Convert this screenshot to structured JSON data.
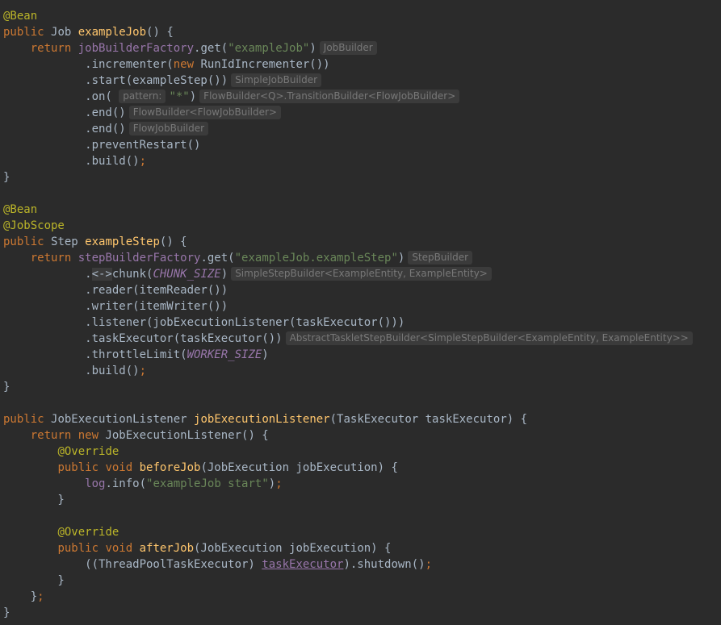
{
  "editor": {
    "theme": "darcula",
    "colors": {
      "background": "#2b2b2b",
      "text": "#a9b7c6",
      "keyword": "#cc7832",
      "annotation": "#bbb529",
      "method_declaration": "#ffc66d",
      "string": "#6a8759",
      "field": "#9876aa",
      "inlay_hint_text": "#787878",
      "inlay_hint_background": "#3b3b3b"
    },
    "lines": [
      [
        {
          "c": "ann",
          "t": "@Bean"
        }
      ],
      [
        {
          "c": "kw",
          "t": "public "
        },
        {
          "t": "Job "
        },
        {
          "c": "fn",
          "t": "exampleJob"
        },
        {
          "t": "() {"
        }
      ],
      [
        {
          "t": "    "
        },
        {
          "c": "kw",
          "t": "return "
        },
        {
          "c": "fld",
          "t": "jobBuilderFactory"
        },
        {
          "t": ".get("
        },
        {
          "c": "str",
          "t": "\"exampleJob\""
        },
        {
          "t": ")"
        },
        {
          "c": "hint",
          "t": "JobBuilder"
        }
      ],
      [
        {
          "t": "            .incrementer("
        },
        {
          "c": "kw",
          "t": "new "
        },
        {
          "t": "RunIdIncrementer())"
        }
      ],
      [
        {
          "t": "            .start(exampleStep())"
        },
        {
          "c": "hint",
          "t": "SimpleJobBuilder"
        }
      ],
      [
        {
          "t": "            .on( "
        },
        {
          "c": "phint",
          "t": "pattern:"
        },
        {
          "c": "str",
          "t": "\"*\""
        },
        {
          "t": ")"
        },
        {
          "c": "hint",
          "t": "FlowBuilder<Q>.TransitionBuilder<FlowJobBuilder>"
        }
      ],
      [
        {
          "t": "            .end()"
        },
        {
          "c": "hint",
          "t": "FlowBuilder<FlowJobBuilder>"
        }
      ],
      [
        {
          "t": "            .end()"
        },
        {
          "c": "hint",
          "t": "FlowJobBuilder"
        }
      ],
      [
        {
          "t": "            .preventRestart()"
        }
      ],
      [
        {
          "t": "            .build()"
        },
        {
          "c": "kw",
          "t": ";"
        }
      ],
      [
        {
          "t": "}"
        }
      ],
      [],
      [
        {
          "c": "ann",
          "t": "@Bean"
        }
      ],
      [
        {
          "c": "ann",
          "t": "@JobScope"
        }
      ],
      [
        {
          "c": "kw",
          "t": "public "
        },
        {
          "t": "Step "
        },
        {
          "c": "fn",
          "t": "exampleStep"
        },
        {
          "t": "() {"
        }
      ],
      [
        {
          "t": "    "
        },
        {
          "c": "kw",
          "t": "return "
        },
        {
          "c": "fld",
          "t": "stepBuilderFactory"
        },
        {
          "t": ".get("
        },
        {
          "c": "str",
          "t": "\"exampleJob.exampleStep\""
        },
        {
          "t": ")"
        },
        {
          "c": "hint",
          "t": "StepBuilder"
        }
      ],
      [
        {
          "t": "            ."
        },
        {
          "c": "dim",
          "t": "<->"
        },
        {
          "t": "chunk("
        },
        {
          "c": "fldi",
          "t": "CHUNK_SIZE"
        },
        {
          "t": ")"
        },
        {
          "c": "hint",
          "t": "SimpleStepBuilder<ExampleEntity, ExampleEntity>"
        }
      ],
      [
        {
          "t": "            .reader(itemReader())"
        }
      ],
      [
        {
          "t": "            .writer(itemWriter())"
        }
      ],
      [
        {
          "t": "            .listener(jobExecutionListener(taskExecutor()))"
        }
      ],
      [
        {
          "t": "            .taskExecutor(taskExecutor())"
        },
        {
          "c": "hint",
          "t": "AbstractTaskletStepBuilder<SimpleStepBuilder<ExampleEntity, ExampleEntity>>"
        }
      ],
      [
        {
          "t": "            .throttleLimit("
        },
        {
          "c": "fldi",
          "t": "WORKER_SIZE"
        },
        {
          "t": ")"
        }
      ],
      [
        {
          "t": "            .build()"
        },
        {
          "c": "kw",
          "t": ";"
        }
      ],
      [
        {
          "t": "}"
        }
      ],
      [],
      [
        {
          "c": "kw",
          "t": "public "
        },
        {
          "t": "JobExecutionListener "
        },
        {
          "c": "fn",
          "t": "jobExecutionListener"
        },
        {
          "t": "(TaskExecutor taskExecutor) {"
        }
      ],
      [
        {
          "t": "    "
        },
        {
          "c": "kw",
          "t": "return new "
        },
        {
          "t": "JobExecutionListener() {"
        }
      ],
      [
        {
          "t": "        "
        },
        {
          "c": "ann",
          "t": "@Override"
        }
      ],
      [
        {
          "t": "        "
        },
        {
          "c": "kw",
          "t": "public void "
        },
        {
          "c": "fn",
          "t": "beforeJob"
        },
        {
          "t": "(JobExecution jobExecution) {"
        }
      ],
      [
        {
          "t": "            "
        },
        {
          "c": "fld",
          "t": "log"
        },
        {
          "t": ".info("
        },
        {
          "c": "str",
          "t": "\"exampleJob start\""
        },
        {
          "t": ")"
        },
        {
          "c": "kw",
          "t": ";"
        }
      ],
      [
        {
          "t": "        }"
        }
      ],
      [],
      [
        {
          "t": "        "
        },
        {
          "c": "ann",
          "t": "@Override"
        }
      ],
      [
        {
          "t": "        "
        },
        {
          "c": "kw",
          "t": "public void "
        },
        {
          "c": "fn",
          "t": "afterJob"
        },
        {
          "t": "(JobExecution jobExecution) {"
        }
      ],
      [
        {
          "t": "            ((ThreadPoolTaskExecutor) "
        },
        {
          "c": "und",
          "t": "taskExecutor"
        },
        {
          "t": ").shutdown()"
        },
        {
          "c": "kw",
          "t": ";"
        }
      ],
      [
        {
          "t": "        }"
        }
      ],
      [
        {
          "t": "    }"
        },
        {
          "c": "kw",
          "t": ";"
        }
      ],
      [
        {
          "t": "}"
        }
      ]
    ]
  }
}
